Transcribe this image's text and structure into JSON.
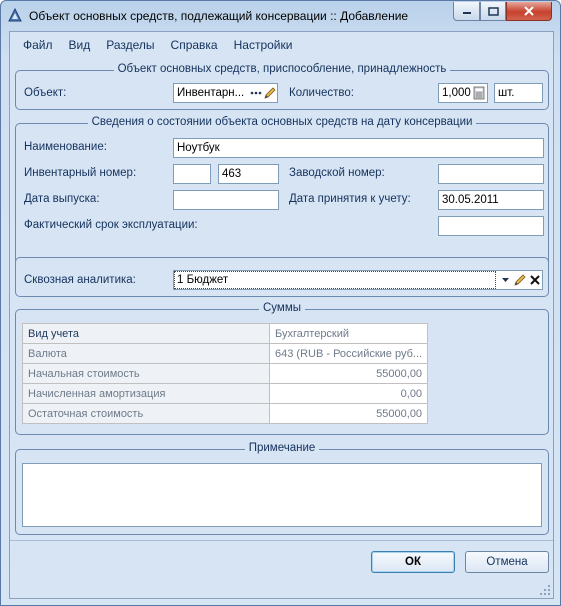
{
  "window": {
    "title": "Объект основных средств, подлежащий консервации :: Добавление"
  },
  "menu": {
    "items": [
      "Файл",
      "Вид",
      "Разделы",
      "Справка",
      "Настройки"
    ]
  },
  "object_group": {
    "legend": "Объект основных средств, приспособление, принадлежность",
    "object_label": "Объект:",
    "object_value": "Инвентарн...",
    "quantity_label": "Количество:",
    "quantity_value": "1,000",
    "unit_value": "шт."
  },
  "state_group": {
    "legend": "Сведения о состоянии объекта основных средств на дату консервации",
    "name_label": "Наименование:",
    "name_value": "Ноутбук",
    "inv_label": "Инвентарный номер:",
    "inv_prefix": "",
    "inv_value": "463",
    "factory_label": "Заводской номер:",
    "factory_value": "",
    "release_label": "Дата выпуска:",
    "release_value": "",
    "accept_label": "Дата принятия к учету:",
    "accept_value": "30.05.2011",
    "term_label": "Фактический срок эксплуатации:",
    "term_value": ""
  },
  "analytics": {
    "label": "Сквозная аналитика:",
    "value": "1 Бюджет"
  },
  "sums": {
    "legend": "Суммы",
    "rows": [
      {
        "key": "Вид учета",
        "value": "Бухгалтерский"
      },
      {
        "key": "Валюта",
        "value": "643 (RUB - Российские руб..."
      },
      {
        "key": "Начальная стоимость",
        "value": "55000,00"
      },
      {
        "key": "Начисленная амортизация",
        "value": "0,00"
      },
      {
        "key": "Остаточная стоимость",
        "value": "55000,00"
      }
    ]
  },
  "note": {
    "legend": "Примечание",
    "value": ""
  },
  "buttons": {
    "ok": "ОК",
    "cancel": "Отмена"
  }
}
